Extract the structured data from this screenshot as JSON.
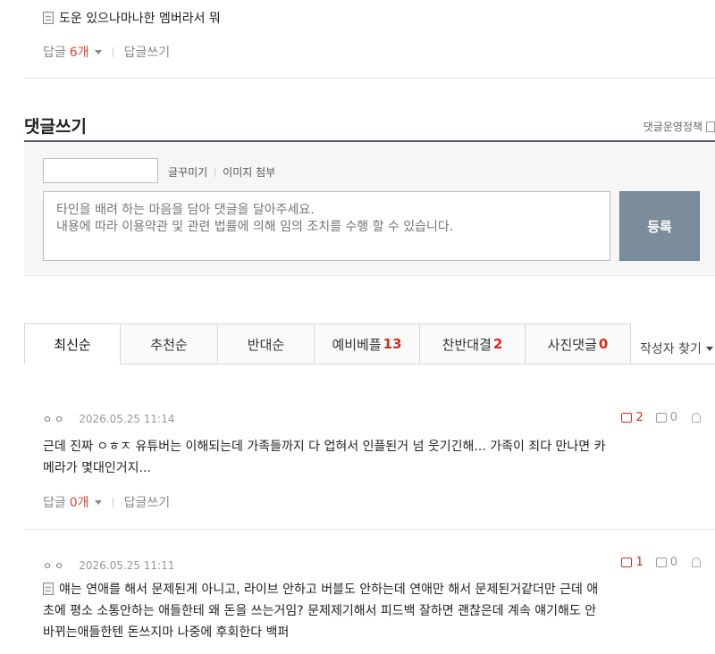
{
  "previous_comment": {
    "text": "도운 있으나마나한 멤버라서 뭐",
    "reply_label": "답글",
    "reply_count": "6개",
    "write_reply_label": "답글쓰기"
  },
  "write_section": {
    "title": "댓글쓰기",
    "policy_link": "댓글운영정책",
    "nickname_value": "",
    "tool_font": "글꾸미기",
    "tool_image": "이미지 첨부",
    "placeholder": "타인을 배려 하는 마음을 담아 댓글을 달아주세요.\n내용에 따라 이용약관 및 관련 법률에 의해 임의 조치를 수행 할 수 있습니다.",
    "submit_label": "등록"
  },
  "tabs": [
    {
      "label": "최신순",
      "count": ""
    },
    {
      "label": "추천순",
      "count": ""
    },
    {
      "label": "반대순",
      "count": ""
    },
    {
      "label": "예비베플",
      "count": "13"
    },
    {
      "label": "찬반대결",
      "count": "2"
    },
    {
      "label": "사진댓글",
      "count": "0"
    }
  ],
  "author_find": "작성자 찾기",
  "comments": [
    {
      "author": "ㅇㅇ",
      "date": "2026.05.25 11:14",
      "upvotes": "2",
      "downvotes": "0",
      "line1": "근데 진짜 ㅇㅎㅈ 유튜버는 이해되는데 가족들까지 다 업혀서 인플된거 넘 웃기긴해... 가족이 죄다 만나면 카",
      "line2": "메라가 몇대인거지...",
      "reply_label": "답글",
      "reply_count": "0개",
      "write_reply_label": "답글쓰기"
    },
    {
      "author": "ㅇㅇ",
      "date": "2026.05.25 11:11",
      "upvotes": "1",
      "downvotes": "0",
      "line1": "얘는 연애를 해서 문제된게 아니고, 라이브 안하고 버블도 안하는데 연애만 해서 문제된거같더만 근데 애",
      "line2": "초에 평소 소통안하는 애들한테 왜 돈을 쓰는거임? 문제제기해서 피드백 잘하면 괜찮은데 계속 얘기해도 안",
      "line3": "바뀌는애들한텐 돈쓰지마 나중에 후회한다 백퍼"
    }
  ]
}
